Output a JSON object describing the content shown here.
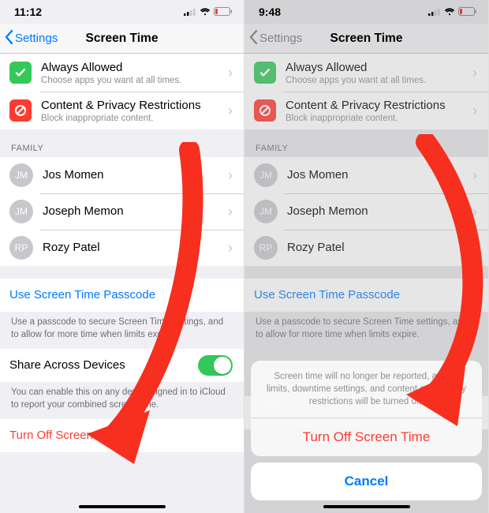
{
  "left": {
    "status_time": "11:12",
    "back_label": "Settings",
    "title": "Screen Time",
    "items": {
      "always_allowed": {
        "title": "Always Allowed",
        "subtitle": "Choose apps you want at all times."
      },
      "content_privacy": {
        "title": "Content & Privacy Restrictions",
        "subtitle": "Block inappropriate content."
      }
    },
    "family_header": "FAMILY",
    "family": [
      {
        "initials": "JM",
        "name": "Jos Momen"
      },
      {
        "initials": "JM",
        "name": "Joseph Memon"
      },
      {
        "initials": "RP",
        "name": "Rozy Patel"
      }
    ],
    "passcode_label": "Use Screen Time Passcode",
    "passcode_footer": "Use a passcode to secure Screen Time settings, and to allow for more time when limits expire.",
    "share_label": "Share Across Devices",
    "share_footer": "You can enable this on any device signed in to iCloud to report your combined screen time.",
    "turnoff_label": "Turn Off Screen Time"
  },
  "right": {
    "status_time": "9:48",
    "back_label": "Settings",
    "title": "Screen Time",
    "items": {
      "always_allowed": {
        "title": "Always Allowed",
        "subtitle": "Choose apps you want at all times."
      },
      "content_privacy": {
        "title": "Content & Privacy Restrictions",
        "subtitle": "Block inappropriate content."
      }
    },
    "family_header": "FAMILY",
    "family": [
      {
        "initials": "JM",
        "name": "Jos Momen"
      },
      {
        "initials": "JM",
        "name": "Joseph Memon"
      },
      {
        "initials": "RP",
        "name": "Rozy Patel"
      }
    ],
    "passcode_label": "Use Screen Time Passcode",
    "passcode_footer": "Use a passcode to secure Screen Time settings, and to allow for more time when limits expire.",
    "turnoff_peek": "Turn Off Screen Time",
    "sheet": {
      "message": "Screen time will no longer be reported, and all limits, downtime settings, and content and privacy restrictions will be turned off.",
      "confirm": "Turn Off Screen Time",
      "cancel": "Cancel"
    }
  },
  "colors": {
    "arrow": "#f62f1f"
  }
}
